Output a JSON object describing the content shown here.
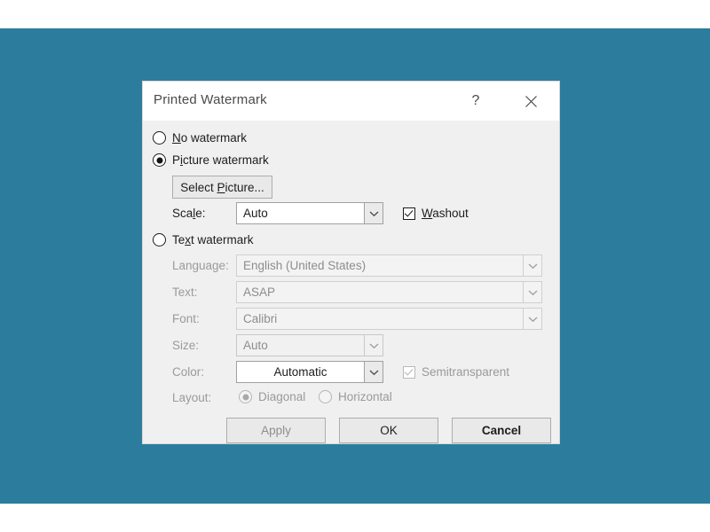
{
  "background": {
    "color": "#2c7d9d",
    "page_color": "#ffffff"
  },
  "dialog": {
    "title": "Printed Watermark",
    "help_button": "?",
    "close_button": "×",
    "body_color": "#f0f0f0",
    "titlebar_color": "#ffffff"
  },
  "options": {
    "no_watermark": {
      "label_before": "",
      "accel": "N",
      "label_after": "o watermark",
      "selected": false
    },
    "picture_watermark": {
      "label_before": "P",
      "accel": "i",
      "label_after": "cture watermark",
      "selected": true
    },
    "text_watermark": {
      "label_before": "Te",
      "accel": "x",
      "label_after": "t watermark",
      "selected": false
    }
  },
  "picture_section": {
    "select_picture_button": {
      "label_before": "Select ",
      "accel": "P",
      "label_after": "icture..."
    },
    "scale": {
      "label_before": "Sca",
      "accel": "l",
      "label_after": "e:",
      "value": "Auto",
      "enabled": true
    },
    "washout": {
      "accel": "W",
      "label_after": "ashout",
      "checked": true,
      "enabled": true
    }
  },
  "text_section": {
    "enabled": false,
    "language": {
      "label": "Language:",
      "value": "English (United States)"
    },
    "text": {
      "label": "Text:",
      "value": "ASAP"
    },
    "font": {
      "label": "Font:",
      "value": "Calibri"
    },
    "size": {
      "label": "Size:",
      "value": "Auto"
    },
    "color": {
      "label": "Color:",
      "value": "Automatic"
    },
    "semitransparent": {
      "label": "Semitransparent",
      "checked": true
    },
    "layout": {
      "label": "Layout:",
      "diagonal": {
        "label": "Diagonal",
        "selected": true
      },
      "horizontal": {
        "label": "Horizontal",
        "selected": false
      }
    }
  },
  "buttons": {
    "apply": "Apply",
    "ok": "OK",
    "cancel": "Cancel"
  }
}
